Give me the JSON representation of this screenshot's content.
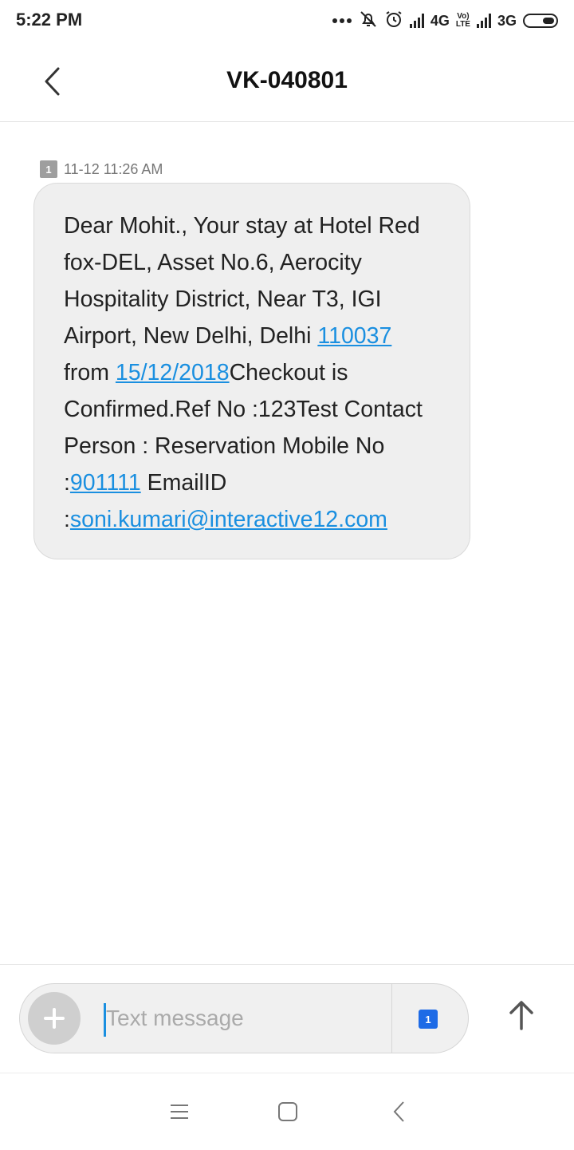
{
  "status_bar": {
    "time": "5:22 PM",
    "network_1": "4G",
    "network_2_top": "Vo)",
    "network_2_bottom": "LTE",
    "network_3": "3G",
    "icons": [
      "more-dots-icon",
      "notifications-off-icon",
      "alarm-icon",
      "signal-icon",
      "signal-icon",
      "battery-icon"
    ]
  },
  "header": {
    "title": "VK-040801",
    "back_icon": "chevron-left-icon"
  },
  "message": {
    "sim_badge": "1",
    "timestamp": "11-12 11:26 AM",
    "text_1": "Dear Mohit., Your stay at Hotel Red fox-DEL, Asset No.6, Aerocity Hospitality District, Near T3, IGI Airport, New Delhi, Delhi ",
    "link_pin": "110037",
    "text_2": " from ",
    "link_date": "15/12/2018",
    "text_3": "Checkout is Confirmed.Ref No :123Test Contact Person : Reservation Mobile No :",
    "link_phone": "901111",
    "text_4": " EmailID :",
    "link_email": "soni.kumari@interactive12.com",
    "link_color": "#1a8fe0"
  },
  "composer": {
    "placeholder": "Text message",
    "value": "",
    "sim_select": "1",
    "sim_color": "#1e6be6",
    "add_icon": "plus-icon",
    "send_icon": "arrow-up-icon"
  },
  "nav_bar": {
    "icons": [
      "menu-icon",
      "home-square-icon",
      "back-icon"
    ]
  }
}
